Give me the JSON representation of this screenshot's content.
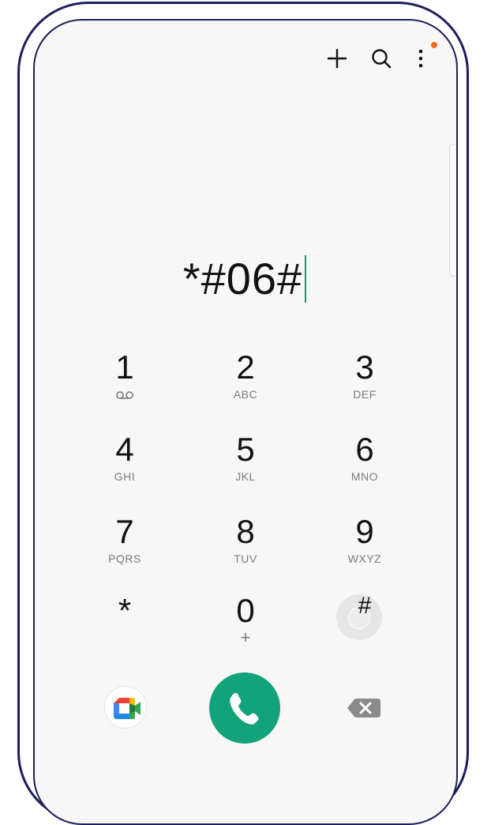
{
  "toolbar": {
    "add_icon": "plus-icon",
    "search_icon": "search-icon",
    "more_icon": "more-vertical-icon",
    "notification_dot_color": "#f26b1d"
  },
  "dialer": {
    "dialed_number": "*#06#",
    "cursor_color": "#119a72"
  },
  "keypad": {
    "keys": [
      {
        "digit": "1",
        "letters": "",
        "sub_icon": "voicemail-icon"
      },
      {
        "digit": "2",
        "letters": "ABC"
      },
      {
        "digit": "3",
        "letters": "DEF"
      },
      {
        "digit": "4",
        "letters": "GHI"
      },
      {
        "digit": "5",
        "letters": "JKL"
      },
      {
        "digit": "6",
        "letters": "MNO"
      },
      {
        "digit": "7",
        "letters": "PQRS"
      },
      {
        "digit": "8",
        "letters": "TUV"
      },
      {
        "digit": "9",
        "letters": "WXYZ"
      },
      {
        "digit": "*",
        "letters": ""
      },
      {
        "digit": "0",
        "letters": "+"
      },
      {
        "digit": "#",
        "letters": ""
      }
    ]
  },
  "actions": {
    "video_call_icon": "google-meet-icon",
    "call_icon": "phone-icon",
    "call_color": "#12a37a",
    "backspace_icon": "backspace-icon"
  }
}
